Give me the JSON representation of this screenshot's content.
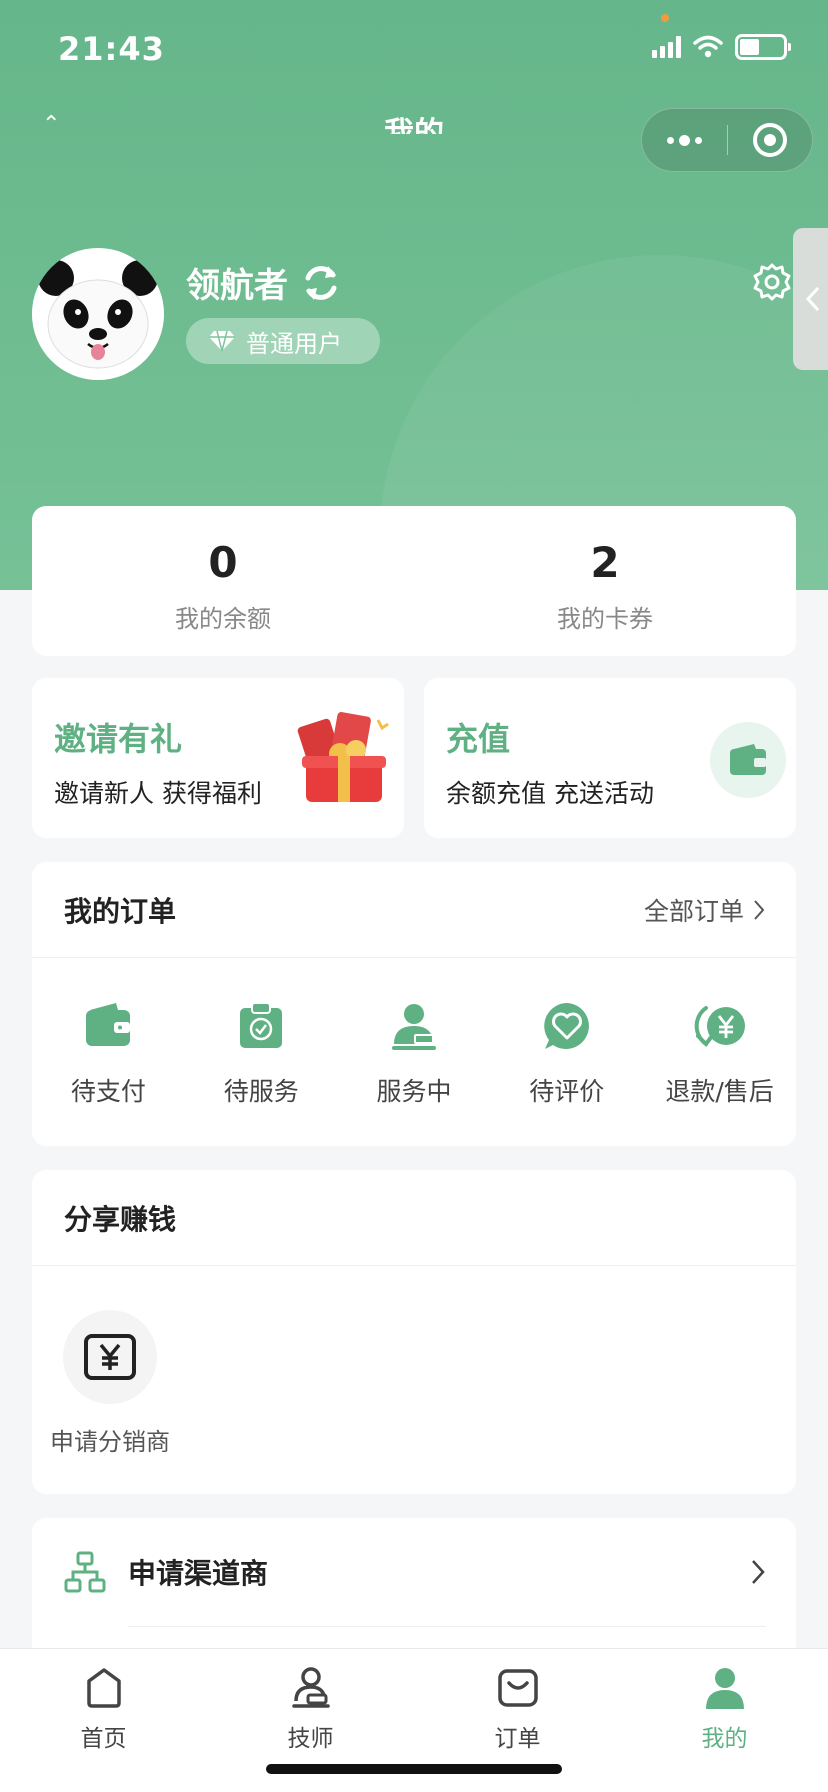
{
  "status_bar": {
    "time": "21:43",
    "icons": [
      "signal-icon",
      "wifi-icon",
      "battery-icon"
    ]
  },
  "nav": {
    "title": "我的",
    "icons": [
      "back-icon",
      "more-icon",
      "close-icon"
    ]
  },
  "profile": {
    "username": "领航者",
    "role": "普通用户",
    "icons": [
      "avatar",
      "sync-icon",
      "diamond-icon",
      "gear-icon"
    ]
  },
  "stats": [
    {
      "value": "0",
      "label": "我的余额"
    },
    {
      "value": "2",
      "label": "我的卡券"
    }
  ],
  "promos": {
    "invite": {
      "title": "邀请有礼",
      "subtitle": "邀请新人 获得福利"
    },
    "recharge": {
      "title": "充值",
      "subtitle": "余额充值 充送活动"
    }
  },
  "orders": {
    "title": "我的订单",
    "all_label": "全部订单",
    "items": [
      {
        "label": "待支付",
        "icon": "wallet-icon"
      },
      {
        "label": "待服务",
        "icon": "clipboard-check-icon"
      },
      {
        "label": "服务中",
        "icon": "user-working-icon"
      },
      {
        "label": "待评价",
        "icon": "heart-chat-icon"
      },
      {
        "label": "退款/售后",
        "icon": "refund-yen-icon"
      }
    ]
  },
  "share": {
    "title": "分享赚钱",
    "items": [
      {
        "label": "申请分销商",
        "icon": "yen-card-icon"
      }
    ]
  },
  "channel": {
    "label": "申请渠道商",
    "icon": "org-chart-icon"
  },
  "tabbar": {
    "items": [
      {
        "label": "首页",
        "icon": "home-icon"
      },
      {
        "label": "技师",
        "icon": "technician-icon"
      },
      {
        "label": "订单",
        "icon": "order-bag-icon"
      },
      {
        "label": "我的",
        "icon": "person-icon"
      }
    ],
    "active_index": 3
  },
  "colors": {
    "primary": "#66b68b",
    "accent": "#5fb083",
    "background": "#f5f6f7"
  }
}
